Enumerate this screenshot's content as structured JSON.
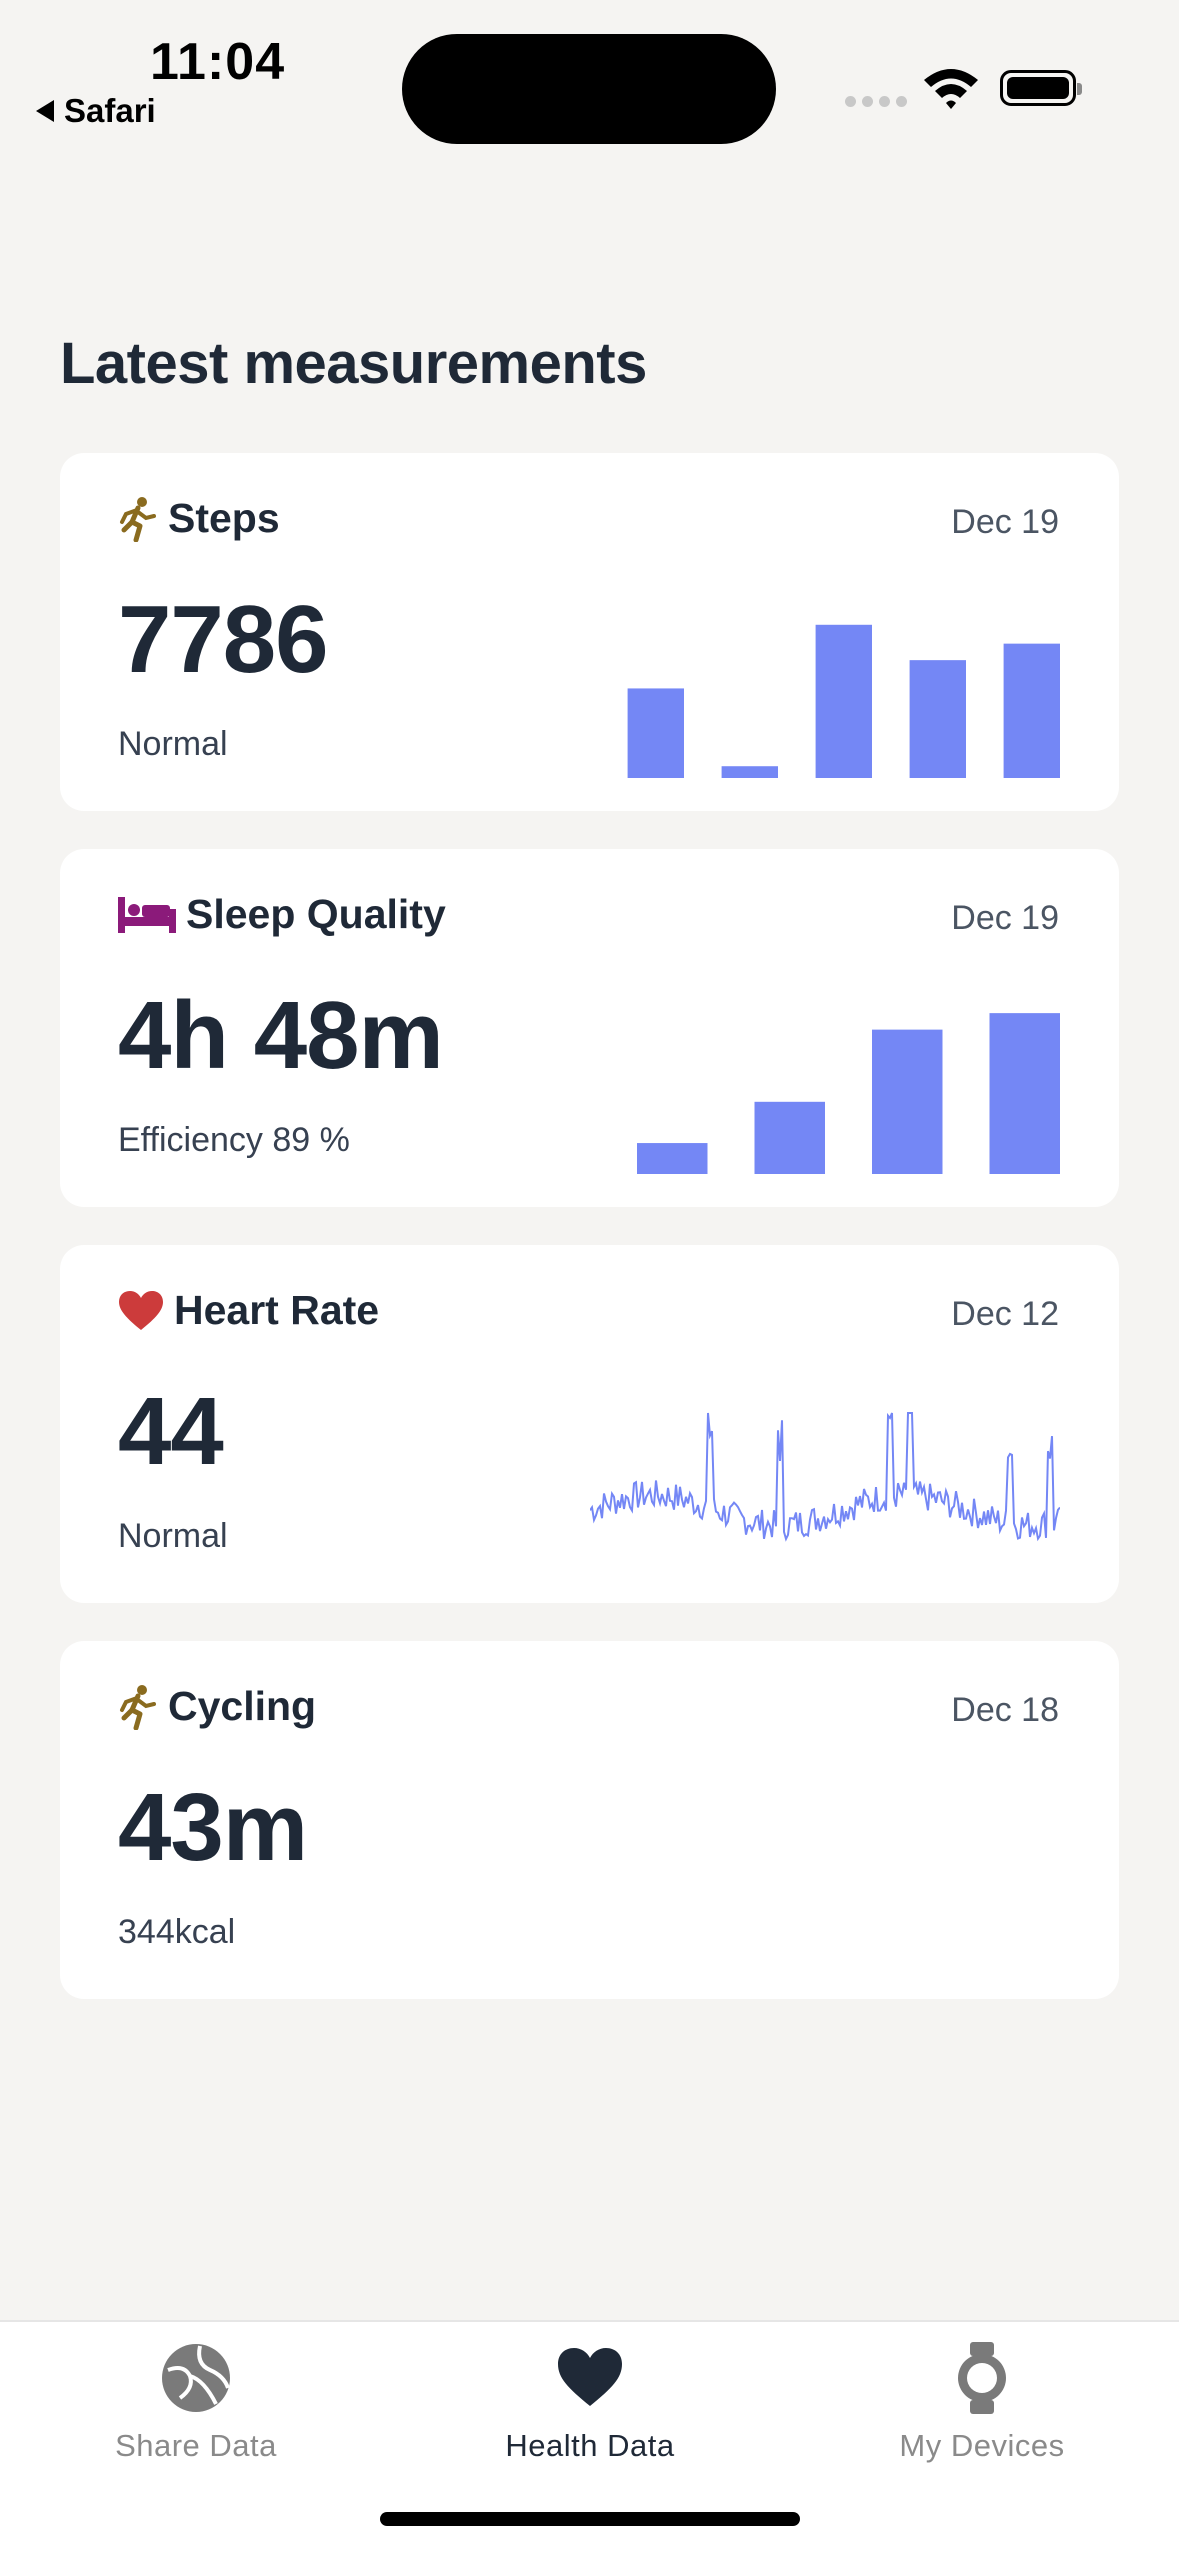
{
  "status_bar": {
    "time": "11:04",
    "back_label": "Safari"
  },
  "section_title": "Latest measurements",
  "colors": {
    "chart": "#7487f5",
    "steps_icon": "#8a6b1f",
    "sleep_icon": "#8b1a7a",
    "heart_icon": "#cc3b3b"
  },
  "cards": [
    {
      "id": "steps",
      "title": "Steps",
      "icon": "runner-icon",
      "date": "Dec 19",
      "value": "7786",
      "sub": "Normal",
      "chart": {
        "type": "bar",
        "values": [
          38,
          5,
          65,
          50,
          57
        ],
        "ylim": [
          0,
          70
        ]
      }
    },
    {
      "id": "sleep",
      "title": "Sleep Quality",
      "icon": "bed-icon",
      "date": "Dec 19",
      "value": "4h 48m",
      "sub": "Efficiency 89 %",
      "chart": {
        "type": "bar",
        "values": [
          15,
          35,
          70,
          78
        ],
        "ylim": [
          0,
          80
        ]
      }
    },
    {
      "id": "heart",
      "title": "Heart Rate",
      "icon": "heart-icon",
      "date": "Dec 12",
      "value": "44",
      "sub": "Normal",
      "chart": {
        "type": "line",
        "ylim": [
          40,
          100
        ]
      }
    },
    {
      "id": "cycling",
      "title": "Cycling",
      "icon": "runner-icon",
      "date": "Dec 18",
      "value": "43m",
      "sub": "344kcal"
    }
  ],
  "tabs": [
    {
      "label": "Share Data",
      "icon": "globe-icon",
      "active": false
    },
    {
      "label": "Health Data",
      "icon": "heart-icon",
      "active": true
    },
    {
      "label": "My Devices",
      "icon": "watch-icon",
      "active": false
    }
  ]
}
